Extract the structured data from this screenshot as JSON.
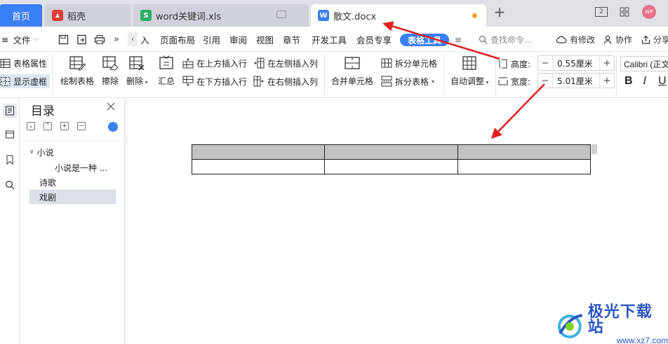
{
  "tabs": [
    {
      "label": "首页",
      "state": "home"
    },
    {
      "label": "稻壳",
      "icon": "docer-icon"
    },
    {
      "label": "word关键词.xls",
      "icon": "spreadsheet-icon"
    },
    {
      "label": "散文.docx",
      "icon": "word-doc-icon",
      "unsaved": true
    }
  ],
  "titlebar": {
    "window_icons": [
      "dual-window-icon",
      "grid-view-icon",
      "bell-icon"
    ],
    "avatar_text": "WP"
  },
  "menu": {
    "file": "文件",
    "items": [
      "入",
      "页面布局",
      "引用",
      "审阅",
      "视图",
      "章节",
      "开发工具",
      "会员专享"
    ],
    "active_pill": "表格工具",
    "more": "≡",
    "search_placeholder": "查找命令...",
    "right": {
      "changes": "有修改",
      "collab": "协作",
      "share": "分享"
    }
  },
  "ribbon": {
    "table_props": "表格属性",
    "show_grid": "显示虚框",
    "draw_table": "绘制表格",
    "erase": "擦除",
    "delete": "删除",
    "summary": "汇总",
    "insert_above": "在上方插入行",
    "insert_below": "在下方插入行",
    "insert_left": "在左侧插入列",
    "insert_right": "在右侧插入列",
    "merge": "合并单元格",
    "split_cell": "拆分单元格",
    "split_table": "拆分表格",
    "autofit": "自动调整",
    "height_label": "高度:",
    "height_value": "0.55厘米",
    "width_label": "宽度:",
    "width_value": "5.01厘米",
    "font_name": "Calibri (正文",
    "bold": "B",
    "italic": "I",
    "underline": "U"
  },
  "toc": {
    "title": "目录",
    "items": [
      {
        "label": "小说",
        "level": 1,
        "expanded": true
      },
      {
        "label": "小说是一种 ...",
        "level": 2
      },
      {
        "label": "诗歌",
        "level": 1
      },
      {
        "label": "戏剧",
        "level": 1,
        "selected": true
      }
    ]
  },
  "document": {
    "table": {
      "rows": 2,
      "cols": 3,
      "header_fill": "#c3c3c3"
    }
  },
  "watermark": {
    "main": "极光下载站",
    "sub": "www.xz7.com"
  },
  "colors": {
    "accent": "#3a7ff3",
    "arrow": "#e02020"
  }
}
